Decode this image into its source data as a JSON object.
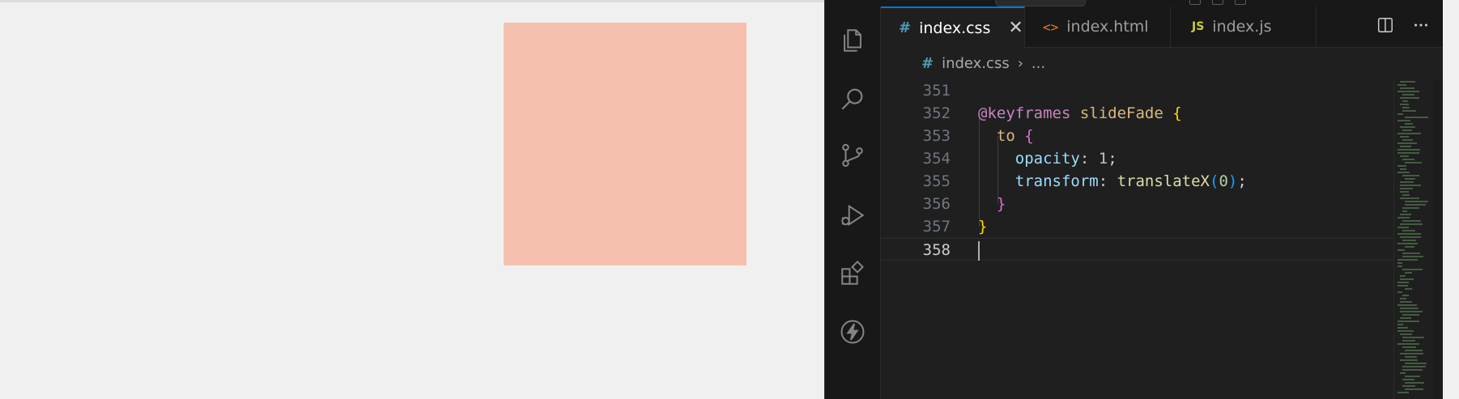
{
  "editor": {
    "tabs": [
      {
        "label": "index.css",
        "icon": "css-hash-icon",
        "active": true
      },
      {
        "label": "index.html",
        "icon": "html-brackets-icon",
        "active": false
      },
      {
        "label": "index.js",
        "icon": "js-icon",
        "active": false
      }
    ],
    "js_badge": "JS",
    "close_glyph": "✕",
    "breadcrumb": {
      "file": "index.css",
      "separator": "›",
      "rest": "..."
    },
    "lines": [
      {
        "number": "351",
        "tokens": []
      },
      {
        "number": "352",
        "tokens": [
          {
            "t": "@keyframes",
            "c": "kw"
          },
          {
            "t": " ",
            "c": "plain"
          },
          {
            "t": "slideFade",
            "c": "sel"
          },
          {
            "t": " ",
            "c": "plain"
          },
          {
            "t": "{",
            "c": "b1"
          }
        ]
      },
      {
        "number": "353",
        "tokens": [
          {
            "t": "  ",
            "c": "plain"
          },
          {
            "t": "to",
            "c": "sel"
          },
          {
            "t": " ",
            "c": "plain"
          },
          {
            "t": "{",
            "c": "b2"
          }
        ]
      },
      {
        "number": "354",
        "tokens": [
          {
            "t": "    ",
            "c": "plain"
          },
          {
            "t": "opacity",
            "c": "prop"
          },
          {
            "t": ": ",
            "c": "plain"
          },
          {
            "t": "1",
            "c": "num"
          },
          {
            "t": ";",
            "c": "plain"
          }
        ]
      },
      {
        "number": "355",
        "tokens": [
          {
            "t": "    ",
            "c": "plain"
          },
          {
            "t": "transform",
            "c": "prop"
          },
          {
            "t": ": ",
            "c": "plain"
          },
          {
            "t": "translateX",
            "c": "fn"
          },
          {
            "t": "(",
            "c": "b3"
          },
          {
            "t": "0",
            "c": "num"
          },
          {
            "t": ")",
            "c": "b3"
          },
          {
            "t": ";",
            "c": "plain"
          }
        ]
      },
      {
        "number": "356",
        "tokens": [
          {
            "t": "  ",
            "c": "plain"
          },
          {
            "t": "}",
            "c": "b2"
          }
        ]
      },
      {
        "number": "357",
        "tokens": [
          {
            "t": "}",
            "c": "b1"
          }
        ]
      },
      {
        "number": "358",
        "tokens": [],
        "current": true
      }
    ]
  },
  "colors": {
    "preview_box": "#f5c1ae",
    "accent": "#0078d4"
  }
}
